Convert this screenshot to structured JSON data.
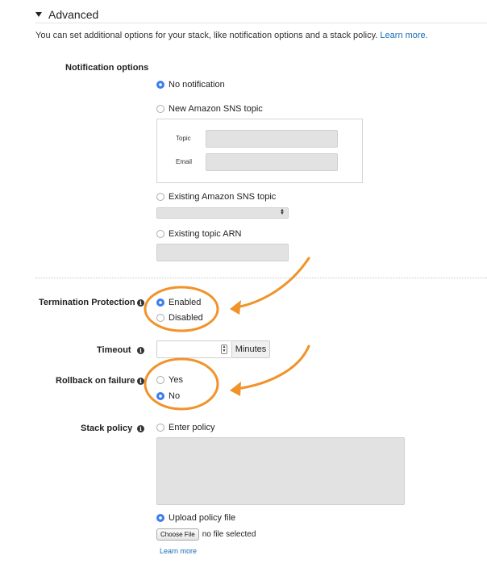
{
  "section": {
    "title": "Advanced",
    "description": "You can set additional options for your stack, like notification options and a stack policy.",
    "learn_more": "Learn more."
  },
  "notification": {
    "label": "Notification options",
    "opt_none": "No notification",
    "opt_new_sns": "New Amazon SNS topic",
    "topic_label": "Topic",
    "email_label": "Email",
    "opt_existing_sns": "Existing Amazon SNS topic",
    "opt_arn": "Existing topic ARN",
    "selected": "No notification"
  },
  "termination": {
    "label": "Termination Protection",
    "opt_enabled": "Enabled",
    "opt_disabled": "Disabled",
    "selected": "Enabled"
  },
  "timeout": {
    "label": "Timeout",
    "value": "",
    "unit": "Minutes"
  },
  "rollback": {
    "label": "Rollback on failure",
    "opt_yes": "Yes",
    "opt_no": "No",
    "selected": "No"
  },
  "stack_policy": {
    "label": "Stack policy",
    "opt_enter": "Enter policy",
    "opt_upload": "Upload policy file",
    "choose_file": "Choose File",
    "file_status": "no file selected",
    "learn_more": "Learn more",
    "selected": "Upload policy file"
  },
  "icons": {
    "info": "i"
  },
  "colors": {
    "link": "#1a6bb8",
    "radio_selected": "#3d7ef0",
    "annotation": "#f0932b"
  }
}
